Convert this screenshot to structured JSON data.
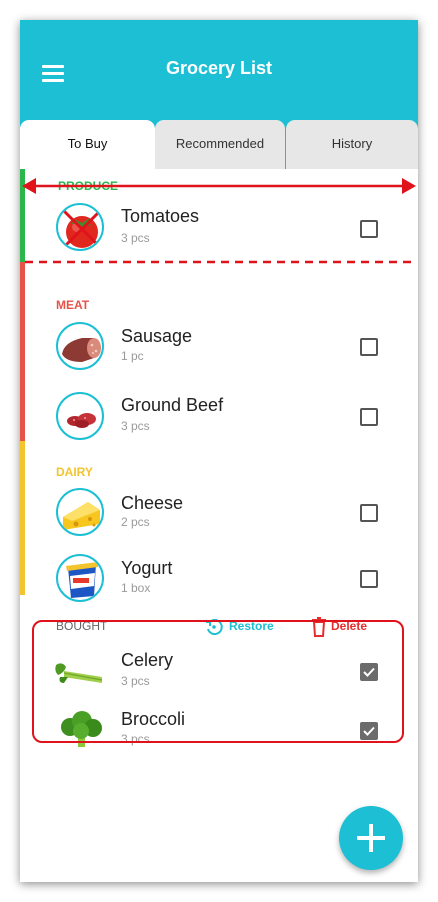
{
  "header": {
    "title": "Grocery List",
    "menu_icon": "hamburger-menu-icon"
  },
  "tabs": [
    {
      "label": "To Buy",
      "active": true
    },
    {
      "label": "Recommended",
      "active": false
    },
    {
      "label": "History",
      "active": false
    }
  ],
  "categories": {
    "produce": {
      "label": "PRODUCE",
      "color": "#2bb54a",
      "items": [
        {
          "name": "Tomatoes",
          "qty": "3 pcs",
          "checked": false,
          "icon": "tomato-icon"
        }
      ]
    },
    "meat": {
      "label": "MEAT",
      "color": "#e5534b",
      "items": [
        {
          "name": "Sausage",
          "qty": "1 pc",
          "checked": false,
          "icon": "sausage-icon"
        },
        {
          "name": "Ground Beef",
          "qty": "3 pcs",
          "checked": false,
          "icon": "ground-beef-icon"
        }
      ]
    },
    "dairy": {
      "label": "DAIRY",
      "color": "#f3c42e",
      "items": [
        {
          "name": "Cheese",
          "qty": "2 pcs",
          "checked": false,
          "icon": "cheese-icon"
        },
        {
          "name": "Yogurt",
          "qty": "1 box",
          "checked": false,
          "icon": "yogurt-icon"
        }
      ]
    }
  },
  "bought": {
    "label": "BOUGHT",
    "restore_label": "Restore",
    "delete_label": "Delete",
    "items": [
      {
        "name": "Celery",
        "qty": "3 pcs",
        "checked": true,
        "icon": "celery-icon"
      },
      {
        "name": "Broccoli",
        "qty": "3 pcs",
        "checked": true,
        "icon": "broccoli-icon"
      }
    ]
  },
  "fab": {
    "icon": "plus-icon"
  },
  "colors": {
    "accent": "#1cbfd4",
    "annotation": "#e0121c",
    "tab_inactive": "#e7e7e7"
  }
}
